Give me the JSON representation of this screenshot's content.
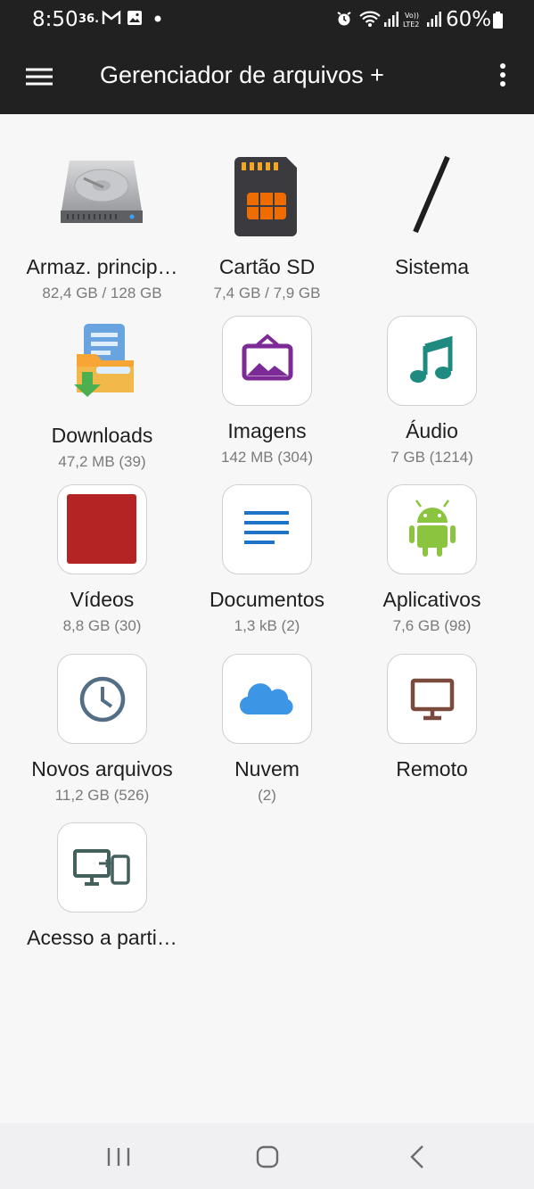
{
  "status_bar": {
    "time": "8:50",
    "network": "36.",
    "battery": "60%",
    "icons": [
      "gmail-icon",
      "gallery-icon",
      "dot-icon",
      "alarm-icon",
      "wifi-icon",
      "signal-icon",
      "volte-icon",
      "signal-icon",
      "battery-icon"
    ]
  },
  "app_bar": {
    "title": "Gerenciador de arquivos +",
    "menu_icon": "hamburger-icon",
    "more_icon": "more-vert-icon"
  },
  "tiles": [
    {
      "label": "Armaz. princip…",
      "meta": "82,4 GB / 128 GB",
      "icon": "hard-drive-icon"
    },
    {
      "label": "Cartão SD",
      "meta": "7,4 GB / 7,9 GB",
      "icon": "sd-card-icon"
    },
    {
      "label": "Sistema",
      "meta": "",
      "icon": "slash-icon"
    },
    {
      "label": "Downloads",
      "meta": "47,2 MB (39)",
      "icon": "download-folder-icon"
    },
    {
      "label": "Imagens",
      "meta": "142 MB (304)",
      "icon": "picture-icon"
    },
    {
      "label": "Áudio",
      "meta": "7 GB (1214)",
      "icon": "music-note-icon"
    },
    {
      "label": "Vídeos",
      "meta": "8,8 GB (30)",
      "icon": "video-icon"
    },
    {
      "label": "Documentos",
      "meta": "1,3 kB (2)",
      "icon": "document-lines-icon"
    },
    {
      "label": "Aplicativos",
      "meta": "7,6 GB (98)",
      "icon": "android-icon"
    },
    {
      "label": "Novos arquivos",
      "meta": "11,2 GB (526)",
      "icon": "clock-icon"
    },
    {
      "label": "Nuvem",
      "meta": "(2)",
      "icon": "cloud-icon"
    },
    {
      "label": "Remoto",
      "meta": "",
      "icon": "monitor-icon"
    },
    {
      "label": "Acesso a parti…",
      "meta": "",
      "icon": "pc-to-phone-icon"
    }
  ],
  "colors": {
    "app_bar": "#212121",
    "background": "#f7f7f8",
    "picture": "#7b2a96",
    "music": "#1f8a80",
    "video": "#b52424",
    "document": "#1e73c8",
    "android": "#8bc53f",
    "clock": "#546e86",
    "cloud": "#3d95e6",
    "monitor": "#7a4a3c",
    "pc_phone": "#44605c"
  },
  "nav_bar": {
    "recents_icon": "recents-icon",
    "home_icon": "home-icon",
    "back_icon": "back-icon"
  }
}
